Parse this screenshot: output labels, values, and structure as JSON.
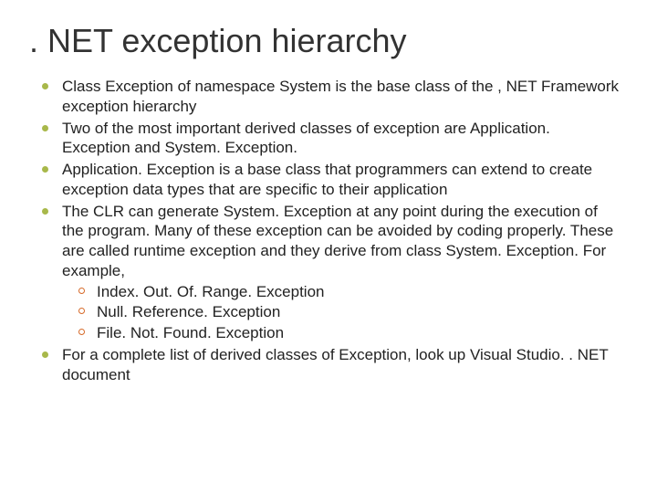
{
  "title": ". NET exception hierarchy",
  "bullets": [
    {
      "text": "Class Exception of namespace System is the base class of the , NET Framework exception hierarchy"
    },
    {
      "text": "Two of the most important derived classes of exception are Application. Exception and System. Exception."
    },
    {
      "text": "Application. Exception is a base class that programmers can extend to create exception data types that are specific to their application"
    },
    {
      "text": "The CLR can generate System. Exception at any point during the execution of the program. Many of these exception can be avoided by coding properly. These are called runtime exception and they derive from class System. Exception. For example,",
      "sub": [
        {
          "text": "Index. Out. Of. Range. Exception"
        },
        {
          "text": "Null. Reference. Exception"
        },
        {
          "text": "File. Not. Found. Exception"
        }
      ]
    },
    {
      "text": "For a complete list of derived classes of Exception, look up Visual Studio. . NET document"
    }
  ]
}
